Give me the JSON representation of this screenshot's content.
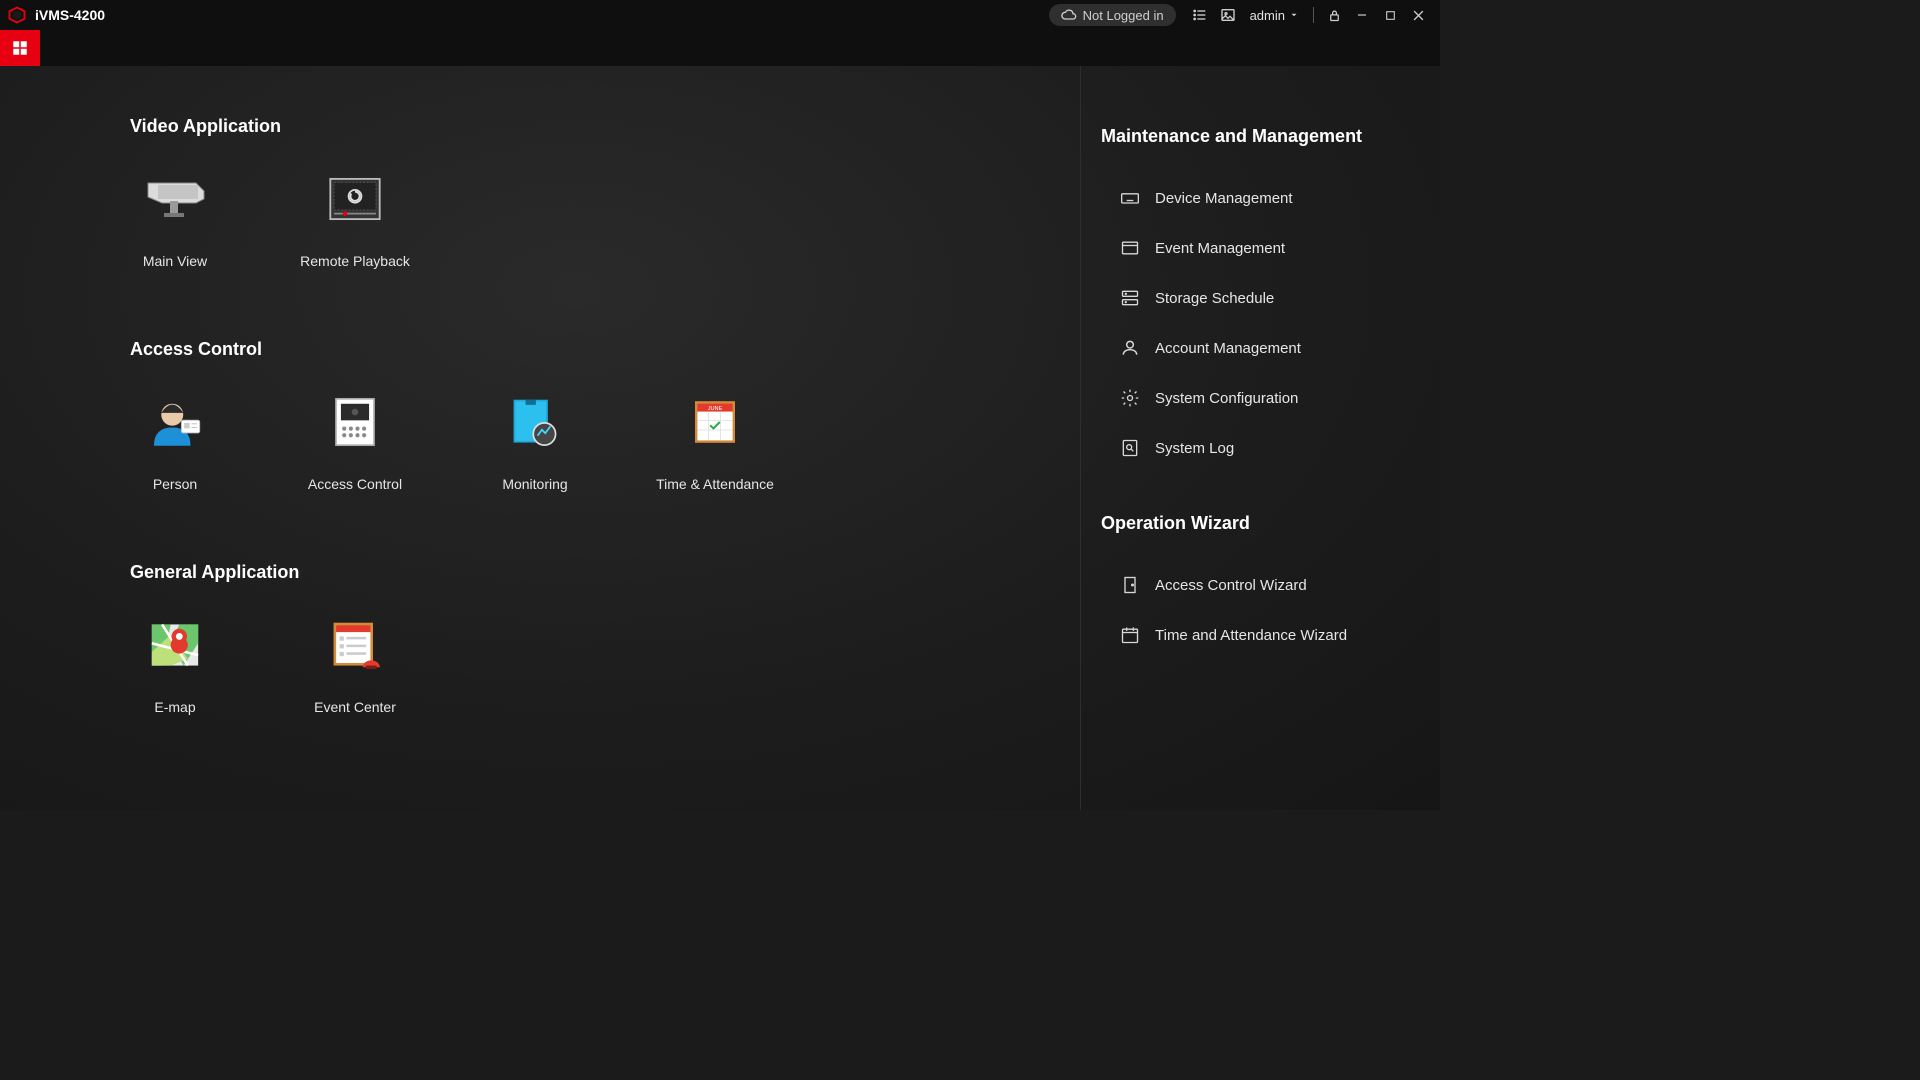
{
  "titlebar": {
    "app_title": "iVMS-4200",
    "login_status": "Not Logged in",
    "user_label": "admin"
  },
  "sections": {
    "video": {
      "title": "Video Application",
      "tiles": {
        "main_view": "Main View",
        "remote_playback": "Remote Playback"
      }
    },
    "access": {
      "title": "Access Control",
      "tiles": {
        "person": "Person",
        "access_control": "Access Control",
        "monitoring": "Monitoring",
        "time_attendance": "Time & Attendance"
      }
    },
    "general": {
      "title": "General Application",
      "tiles": {
        "emap": "E-map",
        "event_center": "Event Center"
      }
    }
  },
  "sidebar": {
    "maintenance": {
      "title": "Maintenance and Management",
      "items": {
        "device_management": "Device Management",
        "event_management": "Event Management",
        "storage_schedule": "Storage Schedule",
        "account_management": "Account Management",
        "system_configuration": "System Configuration",
        "system_log": "System Log"
      }
    },
    "wizard": {
      "title": "Operation Wizard",
      "items": {
        "access_control_wizard": "Access Control Wizard",
        "time_attendance_wizard": "Time and Attendance Wizard"
      }
    }
  }
}
